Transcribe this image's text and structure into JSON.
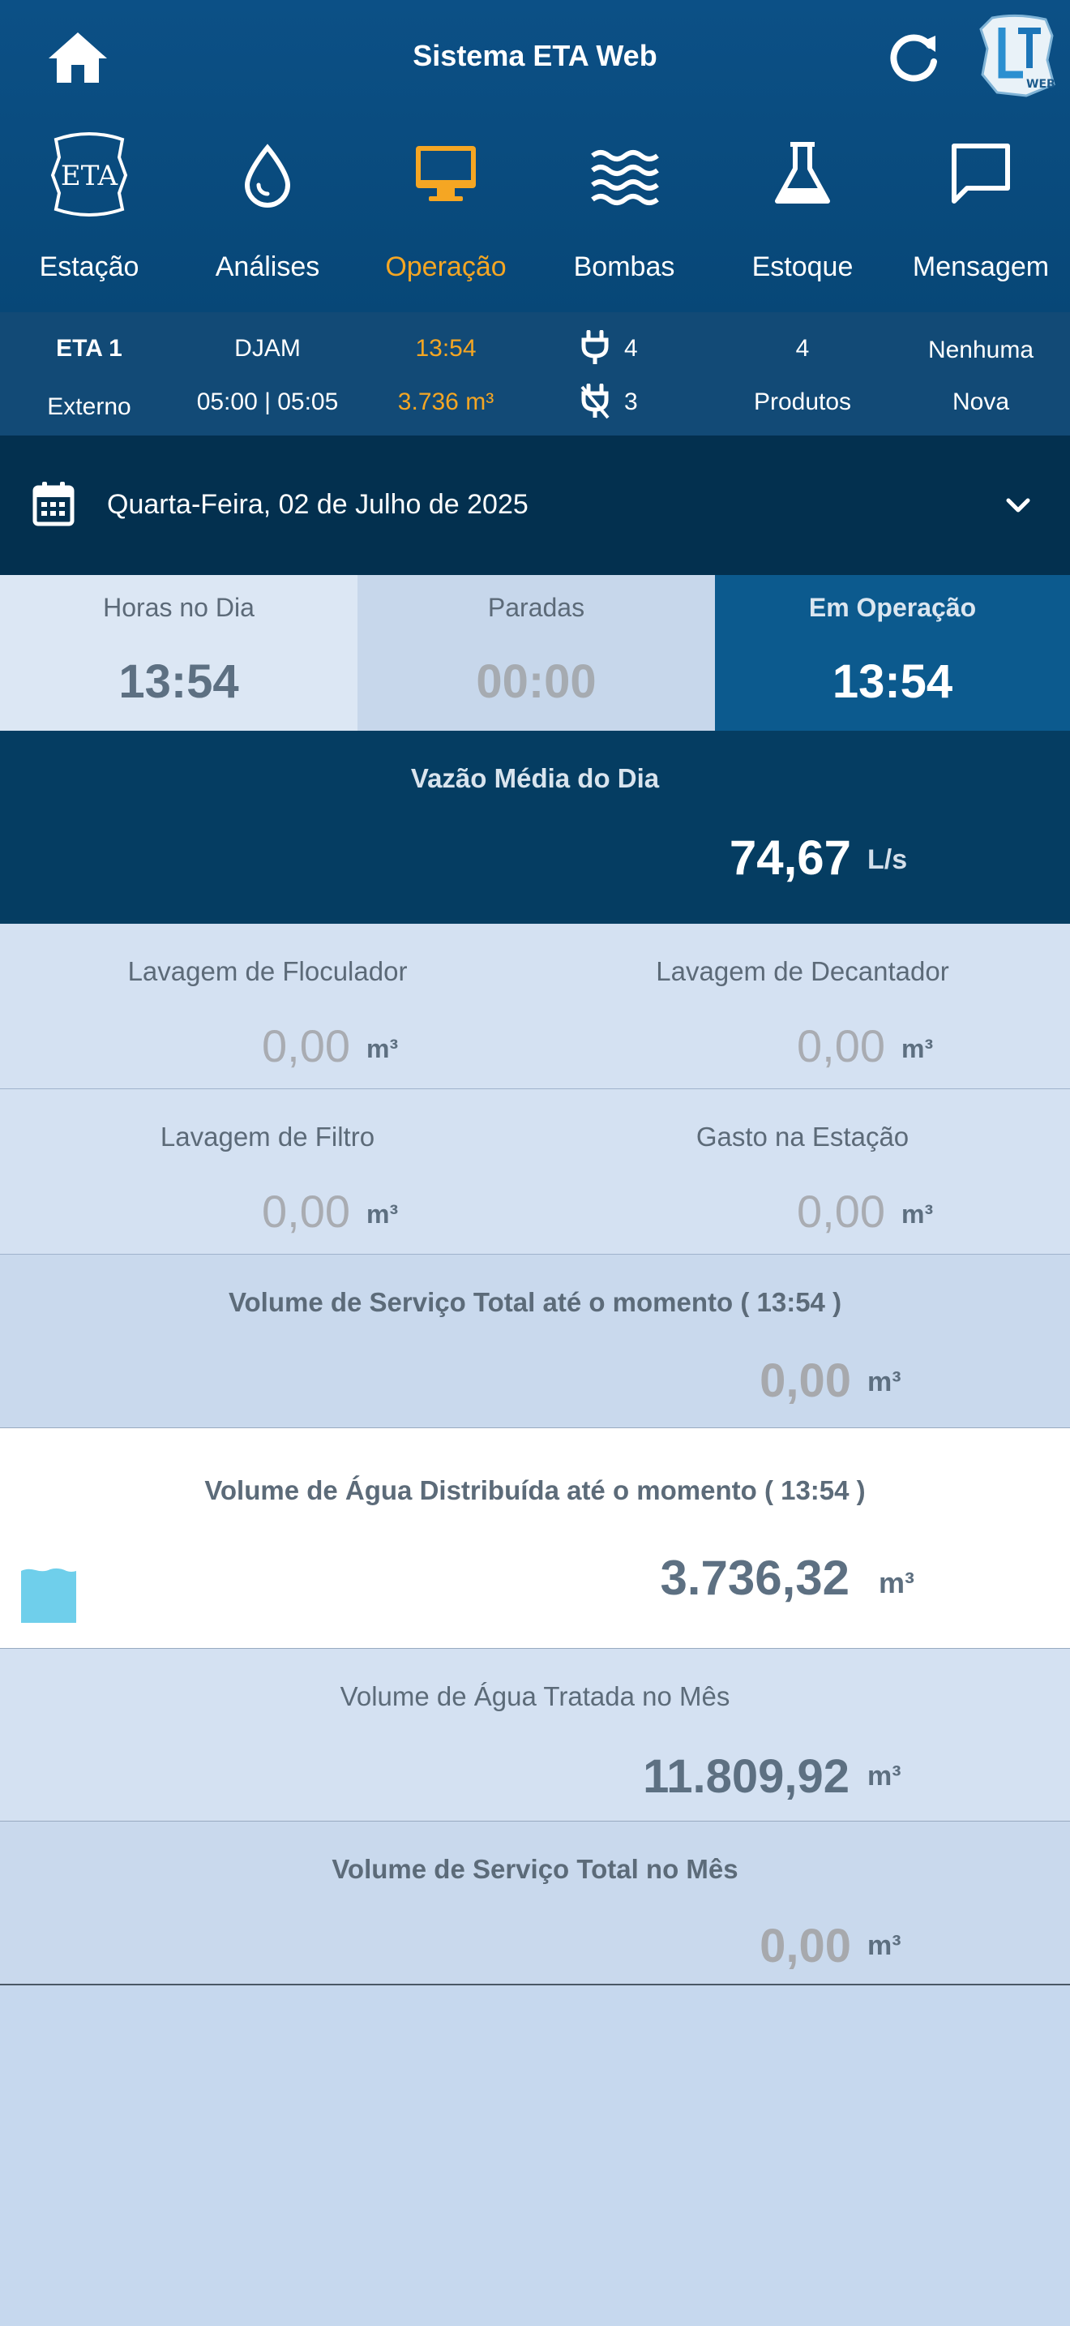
{
  "header": {
    "title": "Sistema ETA Web",
    "logo_text": "ETA WEB"
  },
  "nav": [
    {
      "label": "Estação",
      "icon": "eta-emblem-icon",
      "active": false
    },
    {
      "label": "Análises",
      "icon": "water-drop-icon",
      "active": false
    },
    {
      "label": "Operação",
      "icon": "monitor-icon",
      "active": true
    },
    {
      "label": "Bombas",
      "icon": "waves-icon",
      "active": false
    },
    {
      "label": "Estoque",
      "icon": "flask-icon",
      "active": false
    },
    {
      "label": "Mensagem",
      "icon": "chat-bubble-icon",
      "active": false
    }
  ],
  "status": {
    "station_name": "ETA 1",
    "station_type": "Externo",
    "operator": "DJAM",
    "shift": "05:00 | 05:05",
    "operation_time": "13:54",
    "operation_volume": "3.736 m³",
    "pumps_on": "4",
    "pumps_off": "3",
    "products_count": "4",
    "products_label": "Produtos",
    "message_count": "Nenhuma",
    "message_label": "Nova"
  },
  "date": {
    "text": "Quarta-Feira, 02 de Julho de 2025"
  },
  "hours": {
    "day_label": "Horas no Dia",
    "day_value": "13:54",
    "stops_label": "Paradas",
    "stops_value": "00:00",
    "operating_label": "Em Operação",
    "operating_value": "13:54"
  },
  "flow": {
    "label": "Vazão Média do Dia",
    "value": "74,67",
    "unit": "L/s"
  },
  "washes": {
    "floculador_label": "Lavagem de Floculador",
    "floculador_value": "0,00",
    "decantador_label": "Lavagem de Decantador",
    "decantador_value": "0,00",
    "filtro_label": "Lavagem de Filtro",
    "filtro_value": "0,00",
    "gasto_label": "Gasto na Estação",
    "gasto_value": "0,00",
    "unit": "m³"
  },
  "volumes": {
    "service_now_label": "Volume de Serviço Total até o momento ( 13:54 )",
    "service_now_value": "0,00",
    "distributed_label": "Volume de Água Distribuída até o momento ( 13:54 )",
    "distributed_value": "3.736,32",
    "treated_month_label": "Volume de Água Tratada no Mês",
    "treated_month_value": "11.809,92",
    "service_month_label": "Volume de Serviço Total no Mês",
    "service_month_value": "0,00",
    "unit": "m³",
    "distributed_fill_fraction": 0.45
  },
  "colors": {
    "accent": "#f5a623",
    "header_bg": "#0a4c80",
    "date_bg": "#03304f",
    "flow_bg": "#053d62",
    "operating_bg": "#0c5a8e",
    "water_fill": "#6fcfeb"
  }
}
